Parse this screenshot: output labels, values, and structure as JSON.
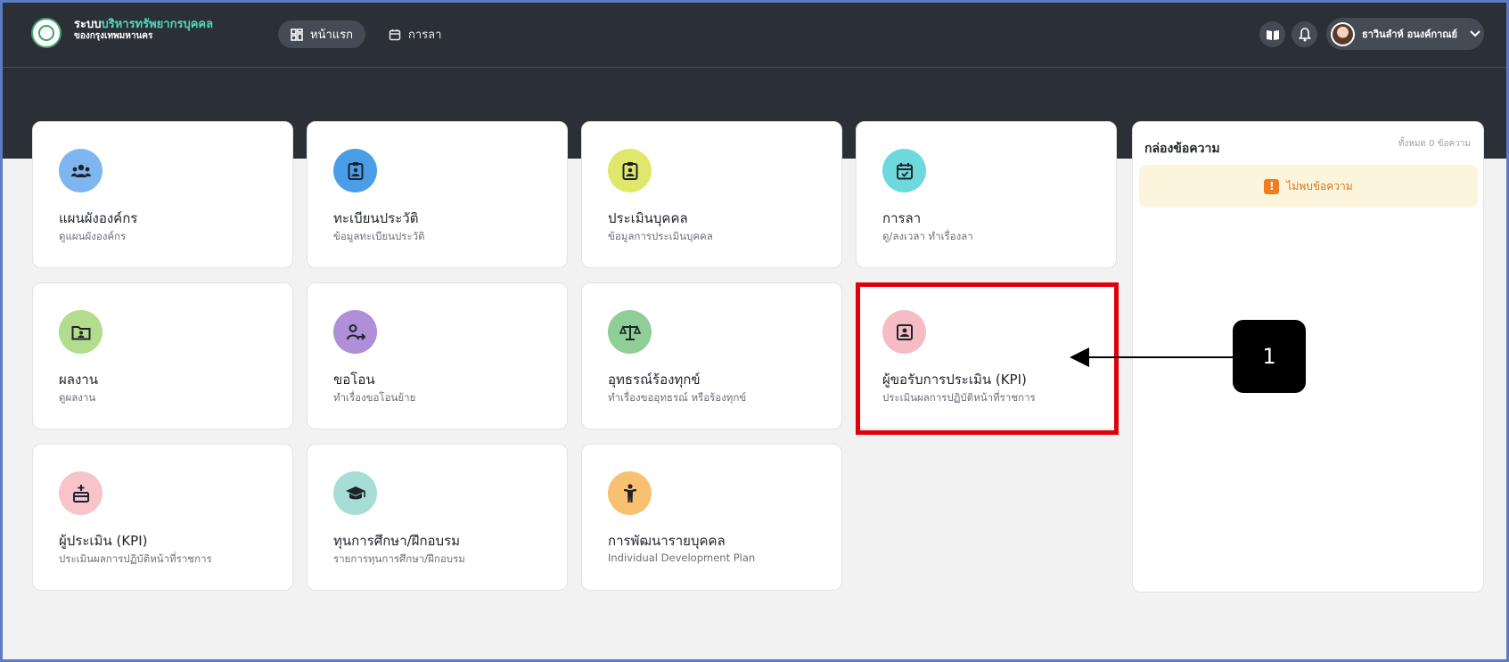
{
  "header": {
    "brand_prefix": "ระบบ",
    "brand_accent": "บริหารทรัพยากรบุคคล",
    "brand_line2": "ของกรุงเทพมหานคร",
    "nav_home": "หน้าแรก",
    "nav_leave": "การลา",
    "user_name": "ธาวินลำห์ อนงค์กาณย์"
  },
  "cards": [
    {
      "title": "แผนผังองค์กร",
      "sub": "ดูแผนผังองค์กร",
      "icon": "people-icon",
      "color": "#7fb6ef"
    },
    {
      "title": "ทะเบียนประวัติ",
      "sub": "ข้อมูลทะเบียนประวัติ",
      "icon": "id-badge-icon",
      "color": "#4a9ee8"
    },
    {
      "title": "ประเมินบุคคล",
      "sub": "ข้อมูลการประเมินบุคคล",
      "icon": "id-badge-icon",
      "color": "#dfe86b"
    },
    {
      "title": "การลา",
      "sub": "ดู/ลงเวลา ทำเรื่องลา",
      "icon": "calendar-icon",
      "color": "#6ed9dd"
    },
    {
      "title": "ผลงาน",
      "sub": "ดูผลงาน",
      "icon": "folder-user-icon",
      "color": "#b3dc8e"
    },
    {
      "title": "ขอโอน",
      "sub": "ทำเรื่องขอโอนย้าย",
      "icon": "user-transfer-icon",
      "color": "#ae8fd8"
    },
    {
      "title": "อุทธรณ์ร้องทุกข์",
      "sub": "ทำเรื่องขออุทธรณ์ หรือร้องทุกข์",
      "icon": "scale-icon",
      "color": "#8fcf97"
    },
    {
      "title": "ผู้ขอรับการประเมิน (KPI)",
      "sub": "ประเมินผลการปฏิบัติหน้าที่ราชการ",
      "icon": "user-card-icon",
      "color": "#f6bcc6"
    },
    {
      "title": "ผู้ประเมิน (KPI)",
      "sub": "ประเมินผลการปฏิบัติหน้าที่ราชการ",
      "icon": "box-add-icon",
      "color": "#f8c3c9"
    },
    {
      "title": "ทุนการศึกษา/ฝึกอบรม",
      "sub": "รายการทุนการศึกษา/ฝึกอบรม",
      "icon": "graduation-cap-icon",
      "color": "#a6ddd7"
    },
    {
      "title": "การพัฒนารายบุคคล",
      "sub": "Individual Development Plan",
      "icon": "person-icon",
      "color": "#f8c172"
    }
  ],
  "inbox": {
    "title": "กล่องข้อความ",
    "count": "ทั้งหมด 0 ข้อความ",
    "empty": "ไม่พบข้อความ"
  },
  "annotation": {
    "label": "1"
  },
  "colors": {
    "topbar": "#2b3037",
    "highlight": "#e0000a",
    "accent": "#4fd6b8"
  }
}
